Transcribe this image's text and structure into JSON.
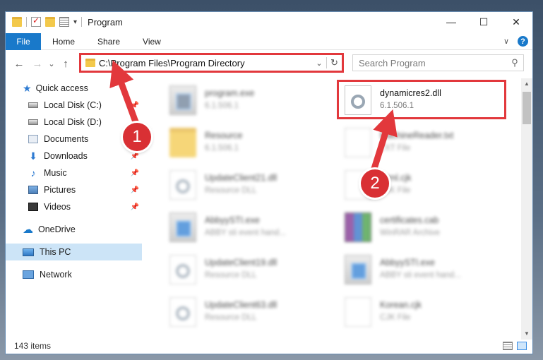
{
  "window": {
    "title": "Program",
    "quick_access_dropdown": "▾",
    "buttons": {
      "minimize": "—",
      "maximize": "☐",
      "close": "✕"
    }
  },
  "ribbon": {
    "tabs": [
      "File",
      "Home",
      "Share",
      "View"
    ],
    "expand": "∨",
    "help": "?"
  },
  "nav": {
    "back": "←",
    "forward": "→",
    "recent": "⌄",
    "up": "↑",
    "address": "C:\\Program Files\\Program Directory",
    "address_dropdown": "⌄",
    "refresh": "↻",
    "search_placeholder": "Search Program",
    "search_icon": "⚲"
  },
  "sidebar": {
    "items": [
      {
        "label": "Quick access",
        "icon": "star-icon"
      },
      {
        "label": "Local Disk (C:)",
        "icon": "disk-icon",
        "pinned": true
      },
      {
        "label": "Local Disk (D:)",
        "icon": "disk-icon",
        "pinned": true
      },
      {
        "label": "Documents",
        "icon": "documents-icon",
        "pinned": true
      },
      {
        "label": "Downloads",
        "icon": "downloads-icon",
        "pinned": true
      },
      {
        "label": "Music",
        "icon": "music-icon",
        "pinned": true
      },
      {
        "label": "Pictures",
        "icon": "pictures-icon",
        "pinned": true
      },
      {
        "label": "Videos",
        "icon": "videos-icon",
        "pinned": true
      },
      {
        "label": "OneDrive",
        "icon": "onedrive-icon"
      },
      {
        "label": "This PC",
        "icon": "this-pc-icon",
        "selected": true
      },
      {
        "label": "Network",
        "icon": "network-icon"
      }
    ],
    "pin_glyph": "📌"
  },
  "files": [
    {
      "name": "program.exe",
      "sub": "6.1.506.1",
      "icon": "exe-icon",
      "blurred": true
    },
    {
      "name": "dynamicres2.dll",
      "sub": "6.1.506.1",
      "icon": "dll-icon",
      "blurred": false,
      "highlighted": true
    },
    {
      "name": "Resource",
      "sub": "6.1.506.1",
      "icon": "folder-icon",
      "blurred": true
    },
    {
      "name": "MachineReader.txt",
      "sub": "TXT File",
      "icon": "text-file-icon",
      "blurred": true
    },
    {
      "name": "UpdateClient21.dll",
      "sub": "Resource DLL",
      "icon": "dll-icon",
      "blurred": true
    },
    {
      "name": "Html.cjk",
      "sub": "CJK File",
      "icon": "file-icon",
      "blurred": true
    },
    {
      "name": "AbbyySTI.exe",
      "sub": "ABBY sti event hand...",
      "icon": "exe-icon",
      "blurred": true
    },
    {
      "name": "certificates.cab",
      "sub": "WinRAR Archive",
      "icon": "rar-icon",
      "blurred": true
    },
    {
      "name": "UpdateClient19.dll",
      "sub": "Resource DLL",
      "icon": "dll-icon",
      "blurred": true
    },
    {
      "name": "AbbyySTI.exe",
      "sub": "ABBY sti event hand...",
      "icon": "exe-icon",
      "blurred": true
    },
    {
      "name": "UpdateClient63.dll",
      "sub": "Resource DLL",
      "icon": "dll-icon",
      "blurred": true
    },
    {
      "name": "Korean.cjk",
      "sub": "CJK File",
      "icon": "file-icon",
      "blurred": true
    }
  ],
  "status": {
    "count": "143 items"
  },
  "callouts": {
    "one": "1",
    "two": "2"
  },
  "colors": {
    "accent": "#1979ca",
    "highlight": "#e2383c",
    "callout": "#d93034",
    "selected": "#cce4f7"
  }
}
